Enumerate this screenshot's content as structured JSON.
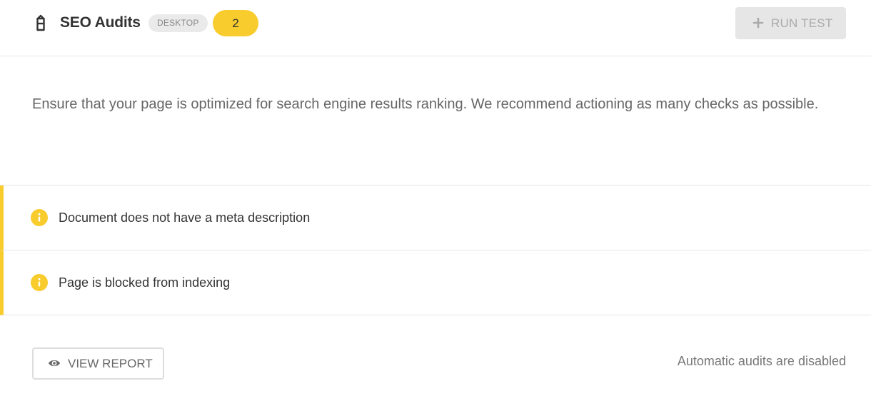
{
  "header": {
    "title": "SEO Audits",
    "title_icon": "lighthouse-icon",
    "device_tag": "DESKTOP",
    "issue_count": "2",
    "run_test_label": "RUN TEST",
    "run_test_icon": "plus-icon",
    "run_test_disabled": true
  },
  "description": "Ensure that your page is optimized for search engine results ranking. We recommend actioning as many checks as possible.",
  "audits": [
    {
      "label": "Document does not have a meta description",
      "icon": "info-icon",
      "status_color": "#f8cc2c"
    },
    {
      "label": "Page is blocked from indexing",
      "icon": "info-icon",
      "status_color": "#f8cc2c"
    }
  ],
  "footer": {
    "view_report_label": "VIEW REPORT",
    "view_report_icon": "eye-icon",
    "auto_audits_status": "Automatic audits are disabled"
  },
  "colors": {
    "accent": "#f8cc2c",
    "text_primary": "#333333",
    "text_muted": "#666666",
    "divider": "#e6e6e6"
  }
}
